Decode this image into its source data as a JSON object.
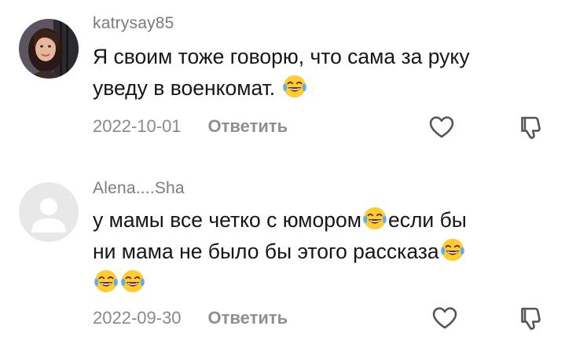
{
  "comments": [
    {
      "username": "katrysay85",
      "text_line1": "Я своим тоже говорю, что сама за руку",
      "text_line2": "уведу в военкомат.",
      "text_line2_emoji": "face-with-tears-of-joy-icon",
      "date": "2022-10-01",
      "reply_label": "Ответить",
      "avatar": "user-photo"
    },
    {
      "username": "Alena....Sha",
      "text_part1": "у мамы все четко с юмором",
      "text_part2": "если бы",
      "text_part3": "ни мама не было бы этого рассказа",
      "text_emoji_count": 4,
      "date": "2022-09-30",
      "reply_label": "Ответить",
      "avatar": "default-avatar"
    }
  ],
  "icons": {
    "like": "heart-outline-icon",
    "dislike": "thumbs-down-outline-icon"
  },
  "colors": {
    "background": "#ffffff",
    "text": "#161616",
    "muted": "#8a8a8a",
    "icon_stroke": "#555555"
  }
}
